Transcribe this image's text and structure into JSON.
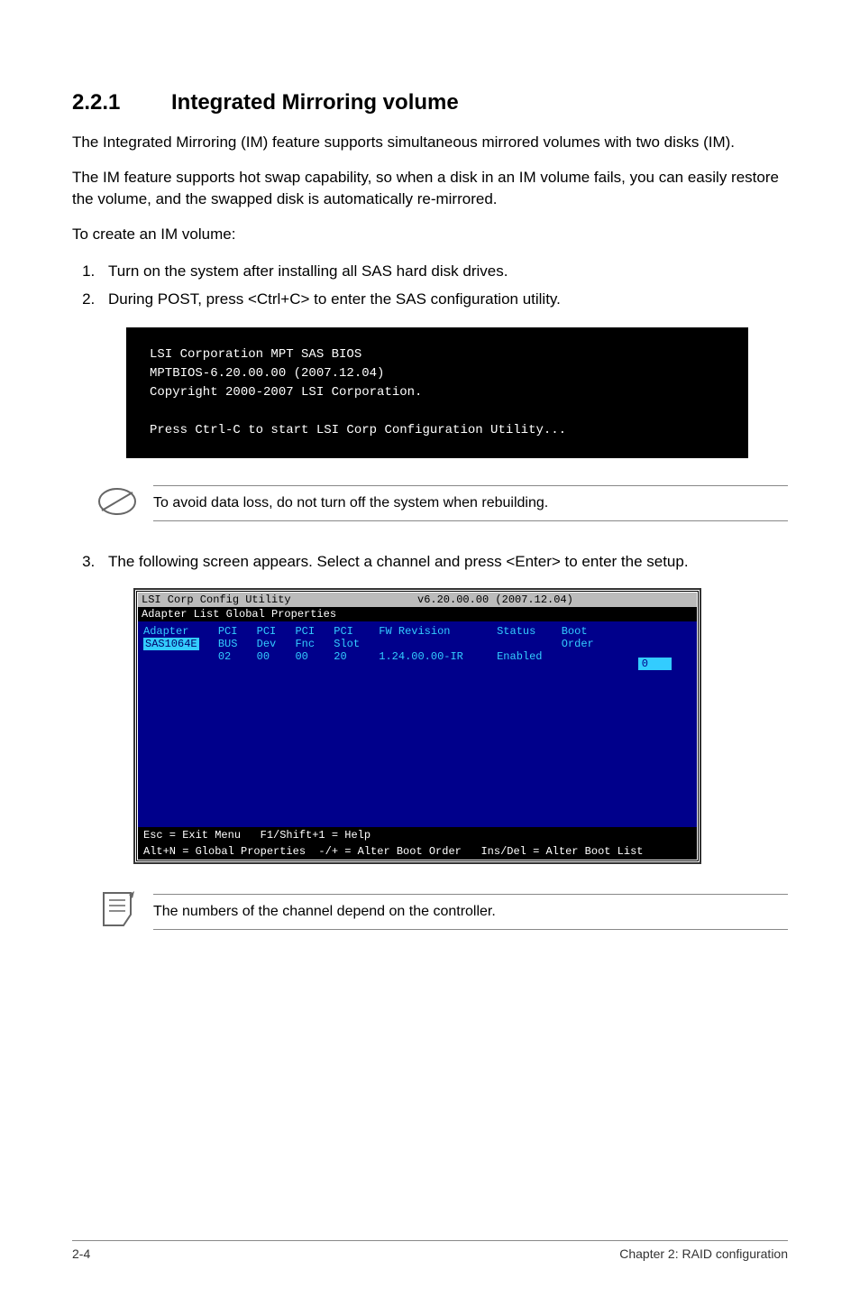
{
  "heading": {
    "number": "2.2.1",
    "title": "Integrated Mirroring volume"
  },
  "para1": "The Integrated Mirroring (IM) feature supports simultaneous mirrored volumes with two disks (IM).",
  "para2": "The IM feature supports hot swap capability, so when a disk in an IM volume fails, you can easily restore the volume, and the swapped disk is automatically re-mirrored.",
  "para3": "To create an IM volume:",
  "steps12": {
    "s1": "Turn on the system after installing all SAS hard disk drives.",
    "s2": "During POST, press <Ctrl+C> to enter the SAS configuration utility."
  },
  "terminal": "LSI Corporation MPT SAS BIOS\nMPTBIOS-6.20.00.00 (2007.12.04)\nCopyright 2000-2007 LSI Corporation.\n\nPress Ctrl-C to start LSI Corp Configuration Utility...",
  "note1": "To avoid data loss, do not turn off the system when rebuilding.",
  "step3": "The following screen appears. Select a channel and press <Enter> to enter the setup.",
  "bios": {
    "title_left": "LSI Corp Config Utility",
    "title_right": "v6.20.00.00 (2007.12.04)",
    "subtitle": "Adapter List  Global Properties",
    "hdr_adapter": "Adapter",
    "hdr_pci_bus": "PCI\nBUS",
    "hdr_pci_dev": "PCI\nDev",
    "hdr_pci_fnc": "PCI\nFnc",
    "hdr_pci_slot": "PCI\nSlot",
    "hdr_fw": "FW Revision",
    "hdr_status": "Status",
    "hdr_boot": "Boot\nOrder",
    "row_adapter": "SAS1064E",
    "row_bus": "02",
    "row_dev": "00",
    "row_fnc": "00",
    "row_slot": "20",
    "row_fw": "1.24.00.00-IR",
    "row_status": "Enabled",
    "row_boot": "0",
    "help1": "Esc = Exit Menu   F1/Shift+1 = Help",
    "help2": "Alt+N = Global Properties  -/+ = Alter Boot Order   Ins/Del = Alter Boot List"
  },
  "note2": "The numbers of the channel depend on the controller.",
  "footer": {
    "left": "2-4",
    "right": "Chapter 2: RAID configuration"
  }
}
